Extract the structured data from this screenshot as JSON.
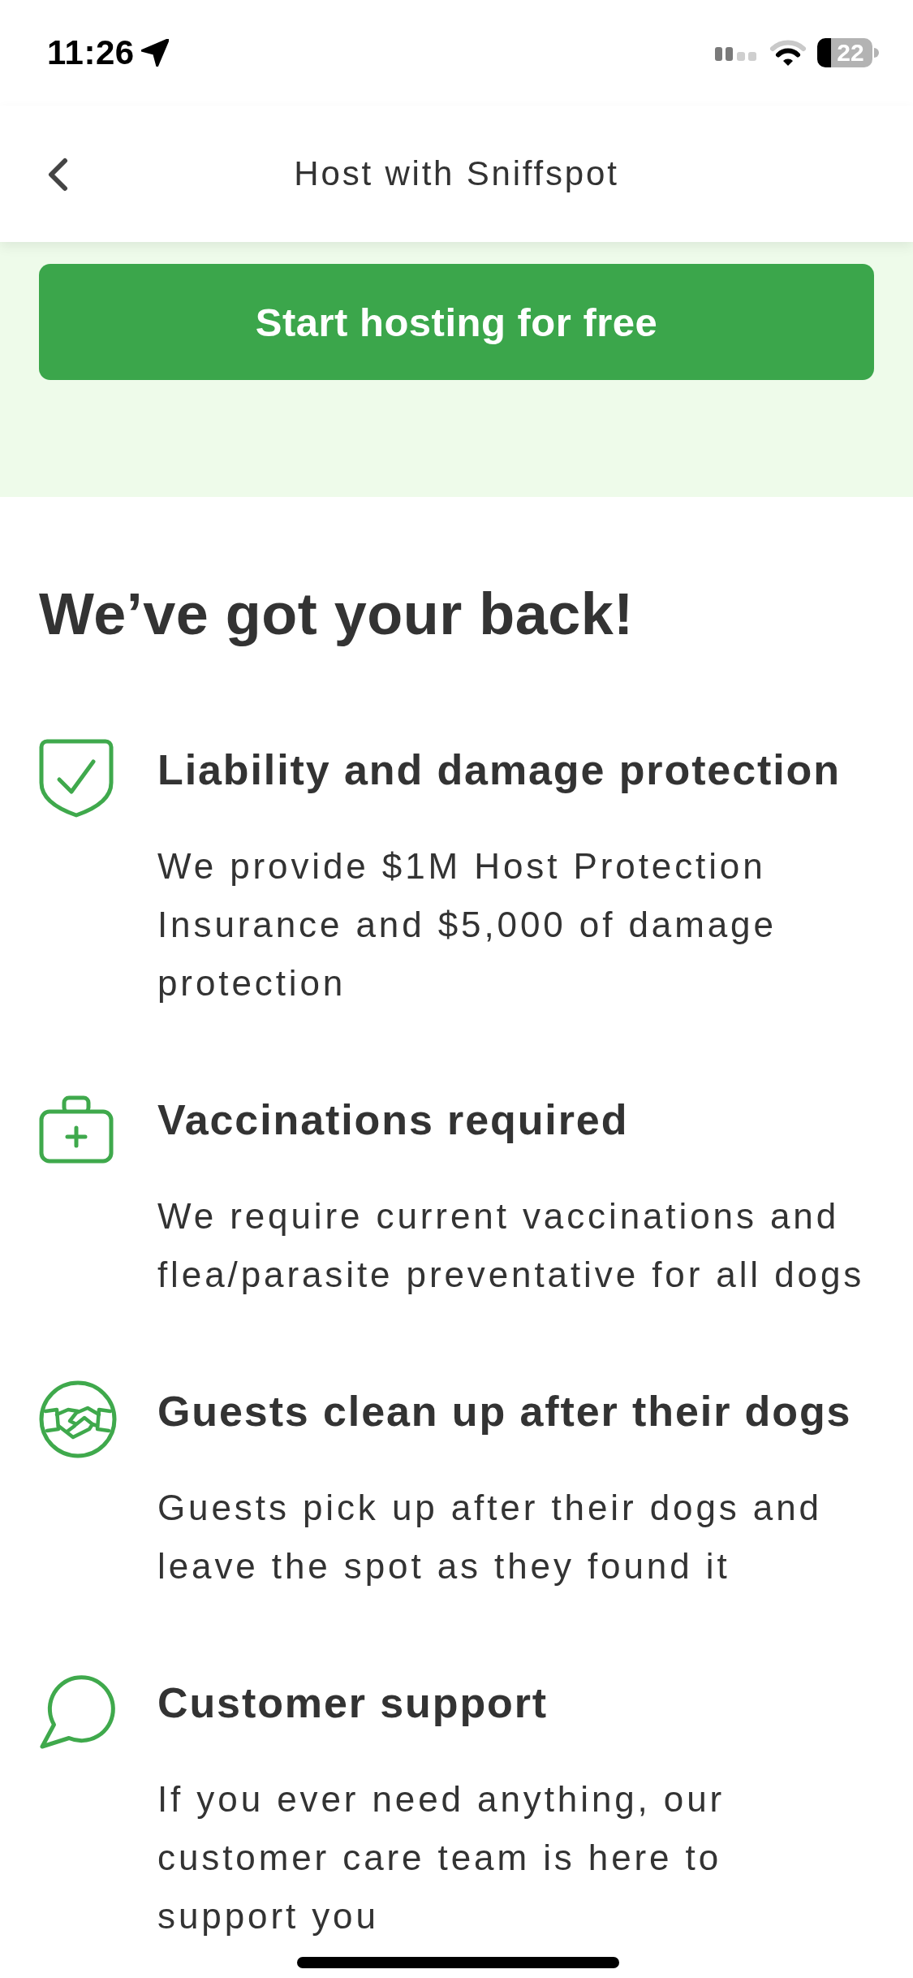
{
  "status_bar": {
    "time": "11:26",
    "battery": "22"
  },
  "nav": {
    "title": "Host with Sniffspot"
  },
  "cta": {
    "label": "Start hosting for free"
  },
  "section": {
    "heading": "We’ve got your back!",
    "features": [
      {
        "kind": "shield",
        "title": "Liability and damage protection",
        "text": "We provide $1M Host Protection Insurance and $5,000 of damage protection"
      },
      {
        "kind": "medkit",
        "title": "Vaccinations required",
        "text": "We require current vaccinations and flea/parasite preventative for all dogs"
      },
      {
        "kind": "handshake",
        "title": "Guests clean up after their dogs",
        "text": "Guests pick up after their dogs and leave the spot as they found it"
      },
      {
        "kind": "chat",
        "title": "Customer support",
        "text": "If you ever need anything, our customer care team is here to support you"
      }
    ]
  }
}
